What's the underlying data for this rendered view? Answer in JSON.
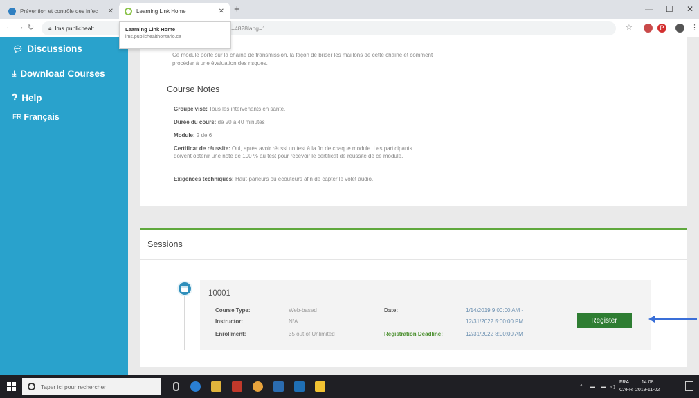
{
  "browser": {
    "tabs": [
      {
        "title": "Prévention et contrôle des infec",
        "active": false
      },
      {
        "title": "Learning Link Home",
        "active": true
      }
    ],
    "new_tab": "+",
    "url_host": "lms.publichealt",
    "url_tail": "a?id=4828lang=1",
    "tooltip": {
      "title": "Learning Link Home",
      "url": "lms.publichealthontario.ca"
    },
    "window_controls": {
      "minimize": "—",
      "maximize": "☐",
      "close": "✕"
    }
  },
  "sidebar": {
    "items": [
      {
        "icon": "chat-icon",
        "label": "Discussions"
      },
      {
        "icon": "download-icon",
        "label": "Download Courses"
      },
      {
        "icon": "help-icon",
        "label": "Help"
      },
      {
        "icon": "language-icon",
        "prefix": "FR",
        "label": "Français"
      }
    ]
  },
  "course": {
    "intro": "Ce module porte sur la chaîne de transmission, la façon de briser les maillons de cette chaîne et comment procéder à une évaluation des risques.",
    "notes_title": "Course Notes",
    "notes": [
      {
        "label": "Groupe visé:",
        "value": "Tous les intervenants en santé."
      },
      {
        "label": "Durée du cours:",
        "value": "de 20 à 40 minutes"
      },
      {
        "label": "Module:",
        "value": "2 de 6"
      },
      {
        "label": "Certificat de réussite:",
        "value": "Oui, après avoir réussi un test à la fin de chaque module. Les participants doivent obtenir une note de 100 % au test pour recevoir le certificat de réussite de ce module."
      },
      {
        "label": "Exigences techniques:",
        "value": "Haut-parleurs ou écouteurs afin de capter le volet audio."
      }
    ]
  },
  "sessions": {
    "title": "Sessions",
    "items": [
      {
        "code": "10001",
        "course_type_label": "Course Type:",
        "course_type": "Web-based",
        "instructor_label": "Instructor:",
        "instructor": "N/A",
        "enrollment_label": "Enrollment:",
        "enrollment": "35 out of Unlimited",
        "date_label": "Date:",
        "date_start": "1/14/2019 9:00:00 AM -",
        "date_end": "12/31/2022 5:00:00 PM",
        "deadline_label": "Registration Deadline:",
        "deadline": "12/31/2022 8:00:00 AM",
        "register_label": "Register"
      }
    ]
  },
  "taskbar": {
    "search_placeholder": "Taper ici pour rechercher",
    "lang": "FRA",
    "locale": "CAFR",
    "time": "14:08",
    "date": "2019-11-02"
  },
  "colors": {
    "sidebar": "#29a2cc",
    "register": "#2e7d32",
    "session_accent": "#5fa83d",
    "arrow": "#3a6fd8"
  }
}
